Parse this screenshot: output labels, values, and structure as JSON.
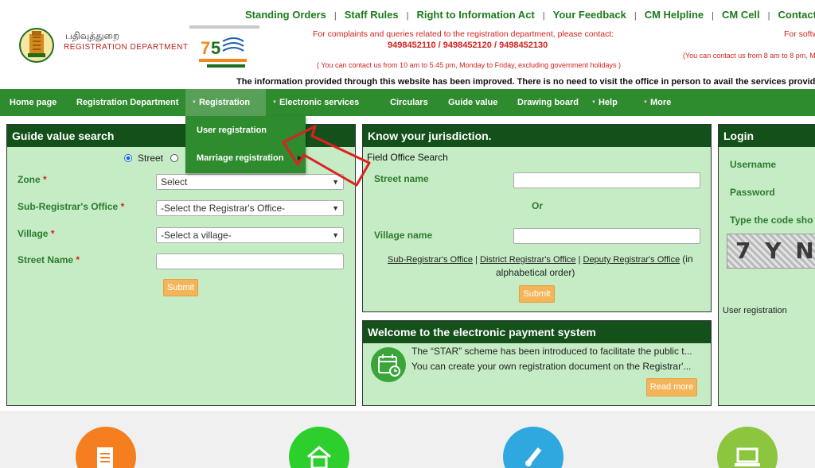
{
  "header": {
    "dept_tamil": "பதிவுத்துறை",
    "dept_english": "REGISTRATION DEPARTMENT",
    "top_links": [
      "Standing Orders",
      "Staff Rules",
      "Right to Information Act",
      "Your Feedback",
      "CM Helpline",
      "CM Cell",
      "Contact U"
    ],
    "complaint_text": "For complaints and queries related to the registration department, please contact:",
    "phone_numbers": "9498452110 / 9498452120 / 9498452130",
    "contact_hours": "( You can contact us from 10 am to 5.45 pm, Monday to Friday, excluding government holidays )",
    "software_text": "For softw",
    "contact_hours_2": "(You can contact us from 8 am to 8 pm, Mo",
    "notice": "The information provided through this website has been improved. There is no need to visit the office in person to avail the services provided o"
  },
  "nav": {
    "items": [
      {
        "label": "Home page"
      },
      {
        "label": "Registration Department"
      },
      {
        "label": "Registration"
      },
      {
        "label": "Electronic services"
      },
      {
        "label": "Circulars"
      },
      {
        "label": "Guide value"
      },
      {
        "label": "Drawing board"
      },
      {
        "label": "Help"
      },
      {
        "label": "More"
      }
    ],
    "dropdown": [
      "User registration",
      "Marriage registration"
    ]
  },
  "guide_value": {
    "title": "Guide value search",
    "radio_street": "Street",
    "zone_label": "Zone",
    "zone_value": "Select",
    "sro_label": "Sub-Registrar's Office",
    "sro_value": "-Select the Registrar's Office-",
    "village_label": "Village",
    "village_value": "-Select a village-",
    "street_label": "Street Name",
    "submit": "Submit"
  },
  "jurisdiction": {
    "title": "Know your jurisdiction.",
    "field_office": "Field Office Search",
    "street_name": "Street name",
    "or": "Or",
    "village_name": "Village name",
    "link_sro": "Sub-Registrar's Office",
    "link_dro": "District Registrar's Office",
    "link_deputy": "Deputy Registrar's Office",
    "suffix": "(in",
    "alphabetical": "alphabetical order)",
    "submit": "Submit"
  },
  "payment": {
    "title": "Welcome to the electronic payment system",
    "line1": "The “STAR” scheme has been introduced to facilitate the public t...",
    "line2": "You can create your own registration document on the Registrar'...",
    "read_more": "Read more"
  },
  "login": {
    "title": "Login",
    "username": "Username",
    "password": "Password",
    "code": "Type the code sho",
    "captcha": "7 Y N",
    "user_registration": "User registration"
  },
  "colors": {
    "nav_green": "#2e8b2e",
    "panel_bg": "#c5ecc5",
    "title_bar": "#14501a",
    "accent_orange": "#f4b55a",
    "alert_red": "#d1251f"
  }
}
